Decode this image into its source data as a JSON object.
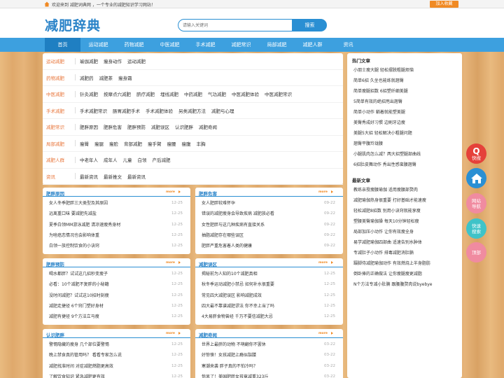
{
  "topbar": {
    "welcome": "欢迎来到 减肥词典网 ，一个专业的减肥知识学习网站！",
    "fav": "加入收藏"
  },
  "header": {
    "logo": "减肥辞典",
    "search_placeholder": "请输入关键词",
    "search_btn": "搜索"
  },
  "nav": [
    "首页",
    "运动减肥",
    "药物减肥",
    "中医减肥",
    "手术减肥",
    "减肥常识",
    "局部减肥",
    "减肥人群",
    "资讯"
  ],
  "categories": [
    {
      "name": "运动减肥",
      "links": [
        "瑜伽减肥",
        "瘦身动作",
        "运动减肥"
      ]
    },
    {
      "name": "药物减肥",
      "links": [
        "减肥药",
        "减肥茶",
        "瘦身霜"
      ]
    },
    {
      "name": "中医减肥",
      "links": [
        "针灸减肥",
        "按摩点穴减肥",
        "脐疗减肥",
        "埋线减肥",
        "中药减肥",
        "气功减肥",
        "中医减肥体验",
        "中医减肥常识"
      ]
    },
    {
      "name": "手术减肥",
      "links": [
        "手术减肥常识",
        "肠胃减肥手术",
        "手术减肥体验",
        "另类减肥方法",
        "减肥与心理"
      ]
    },
    {
      "name": "减肥常识",
      "links": [
        "肥胖原因",
        "肥胖危害",
        "肥胖预防",
        "减肥误区",
        "认识肥胖",
        "减肥奇闻"
      ]
    },
    {
      "name": "局部减肥",
      "links": [
        "瘦臀",
        "瘦腿",
        "瘦脸",
        "背部减肥",
        "瘦手臂",
        "瘦腰",
        "瘦腹",
        "丰胸"
      ]
    },
    {
      "name": "减肥人群",
      "links": [
        "中老年人",
        "成年人",
        "儿童",
        "白领",
        "产后减肥"
      ]
    },
    {
      "name": "资讯",
      "links": [
        "最新资讯",
        "最新推文",
        "最新资讯"
      ]
    }
  ],
  "panels": [
    {
      "title": "肥胖原因",
      "more": "more",
      "items": [
        [
          "女人冬季肥胖三大类型及其原因",
          "12-25"
        ],
        [
          "远离重口味 要减肥先减盐",
          "12-25"
        ],
        [
          "夏季白领MM游泳减肥 清凉速瘦秀身材",
          "12-25"
        ],
        [
          "为啥癌恋情况也会影响体重",
          "12-25"
        ],
        [
          "白领一族控制饮食的小诀窍",
          "12-25"
        ]
      ]
    },
    {
      "title": "肥胖危害",
      "more": "more",
      "items": [
        [
          "女人肥胖较难怀孕",
          "09-22"
        ],
        [
          "错误的减肥瘦身会导致疾病 减肥族必看",
          "09-22"
        ],
        [
          "女性肥胖与这几种疾病有直接关系",
          "09-22"
        ],
        [
          "抽脂减肥存在哪些误区",
          "09-22"
        ],
        [
          "肥胖严重危害着人类的健康",
          "09-22"
        ]
      ]
    },
    {
      "title": "肥胖预防",
      "more": "more",
      "items": [
        [
          "喝水都胖？试试这几招秒变瘦子",
          "12-25"
        ],
        [
          "必看：10个减肥不复胖的小秘籍",
          "12-25"
        ],
        [
          "没时间减肥？试试这10招时刻瘦",
          "12-25"
        ],
        [
          "减肥走捷径 6个窍门塑好身材",
          "12-25"
        ],
        [
          "减肥有捷径 9个方法立马瘦",
          "12-25"
        ]
      ]
    },
    {
      "title": "减肥误区",
      "more": "more",
      "items": [
        [
          "揭秘前为人知的10个减肥真相",
          "12-25"
        ],
        [
          "秋冬季运动减肥小禁忌 如何补水很重要",
          "12-25"
        ],
        [
          "常见四大减肥误区 影响减肥成效",
          "12-25"
        ],
        [
          "四大最不靠谱减肥谬法 你不幸上当了吗",
          "12-25"
        ],
        [
          "4大易胖食物曾经 千万不要信减肥大忌",
          "12-25"
        ]
      ]
    },
    {
      "title": "认识肥胖",
      "more": "more",
      "items": [
        [
          "警惕隐藏的瘦身 几个部位要警惕",
          "12-25"
        ],
        [
          "晚上禁食真的管用吗？ 看看专家怎么说",
          "12-25"
        ],
        [
          "减肥找准时间 对症减肥燃脂更高效",
          "12-25"
        ],
        [
          "了解饮食知识 紧急减肥更有效",
          "12-25"
        ]
      ]
    },
    {
      "title": "减肥奇闻",
      "more": "more",
      "items": [
        [
          "世界上最胖的动物 不萌翻你不罢休",
          "03-22"
        ],
        [
          "好惊悚！女孩减肥上瘾似骷髅",
          "03-22"
        ],
        [
          "寒潮来袭 胖子真的不怕冷吗？",
          "03-22"
        ],
        [
          "惊呆了！美国肥胖女孩竟减重323斤",
          "03-22"
        ]
      ]
    }
  ],
  "sidebar": {
    "hot_title": "热门文章",
    "hot": [
      "小朋士瘦大腿 轻松摆脱粗腿烦恼",
      "简单6招 久坐也能练就翘臀",
      "简单瘦腿招数 6招塑纤细美腿",
      "5简单有效的绝招甩出翘臀",
      "简单小动作 躺着就能塑美腿",
      "美臀秀成好习惯 边刷牙边瘦",
      "美腿5大招 轻松解决小粗腿问题",
      "翘臀平腹玲珑腰",
      "小腿肌肉怎么减？两大招塑腿部曲线",
      "6招肚皮舞动作 秀出性感蛮腰翘臀"
    ],
    "new_title": "最新文章",
    "new": [
      "教练亲授瘦腰瑜伽 适用瘦腰部赘肉",
      "减肥瑜伽热身很重要 打好基础才能速瘦",
      "轻松减肥8招数 别用小诀窍就能享瘦",
      "塑腰美臀瑜伽操 每天10分钟轻松瘦",
      "局部加压小动作 让你有效瘦全身",
      "易学减肥瑜伽四部曲 适速告别水肿体",
      "专减肚子小动作 排毒减肥消肚腩",
      "蹑脚侍减肥瑜伽动作 有效燃烧上半身脂肪",
      "倒卧捧的正确做法 让你瘦腿瘦更减脂",
      "N个方法专减小肚腩 跟腰腹赘肉说byebye"
    ]
  },
  "float": [
    {
      "label": "快搜",
      "icon": "Q"
    },
    {
      "label": "",
      "icon": "home-icon"
    },
    {
      "label": "网站\n导航"
    },
    {
      "label": "快速\n搜索"
    },
    {
      "label": "顶部"
    }
  ]
}
